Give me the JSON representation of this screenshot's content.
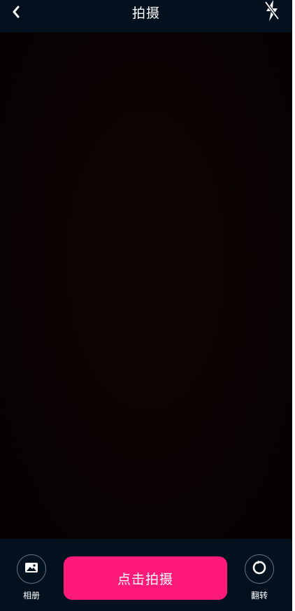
{
  "header": {
    "title": "拍摄",
    "back_icon": "chevron-left-icon",
    "flash_icon": "flash-off-icon"
  },
  "bottom": {
    "album_label": "相册",
    "album_icon": "image-icon",
    "capture_label": "点击拍摄",
    "flip_label": "翻转",
    "flip_icon": "rotate-icon"
  },
  "colors": {
    "accent": "#ff1a7a",
    "bar_background": "#03111f",
    "viewfinder": "#0a0202"
  }
}
